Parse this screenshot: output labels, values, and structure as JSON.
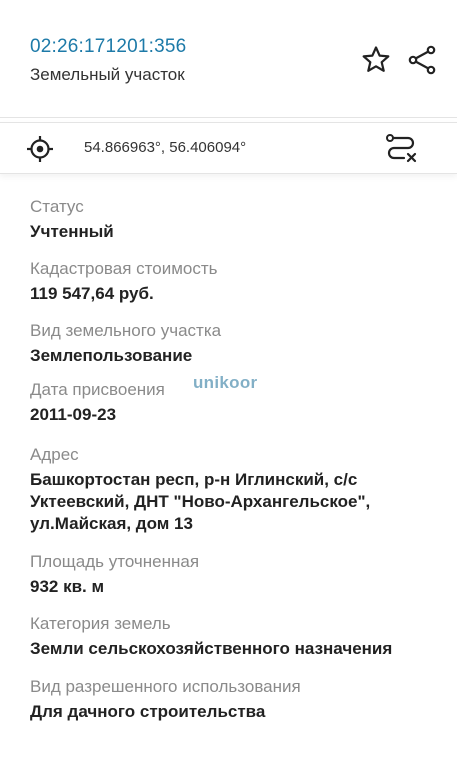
{
  "header": {
    "cadastral_number": "02:26:171201:356",
    "object_type": "Земельный участок",
    "favorite_icon": "star-outline-icon",
    "share_icon": "share-icon"
  },
  "location": {
    "coordinates": "54.866963°, 56.406094°",
    "locate_icon": "crosshair-location-icon",
    "route_icon": "route-icon"
  },
  "partial_text": "02:26:171201:356",
  "fields": [
    {
      "label": "Статус",
      "value": "Учтенный"
    },
    {
      "label": "Кадастровая стоимость",
      "value": "119 547,64 руб."
    },
    {
      "label": "Вид земельного участка",
      "value": "Землепользование"
    },
    {
      "label": "Дата присвоения",
      "value": "2011-09-23"
    },
    {
      "label": "Адрес",
      "value": "Башкортостан респ, р-н Иглинский, с/с Уктеевский, ДНТ \"Ново-Архангельское\", ул.Майская, дом 13"
    },
    {
      "label": "Площадь уточненная",
      "value": "932 кв. м"
    },
    {
      "label": "Категория земель",
      "value": "Земли сельскохозяйственного назначения"
    },
    {
      "label": "Вид разрешенного использования",
      "value": "Для дачного строительства"
    }
  ],
  "watermark": "unikoor",
  "colors": {
    "accent": "#1d7aa8",
    "label": "#8a8a8a",
    "value": "#222222"
  }
}
